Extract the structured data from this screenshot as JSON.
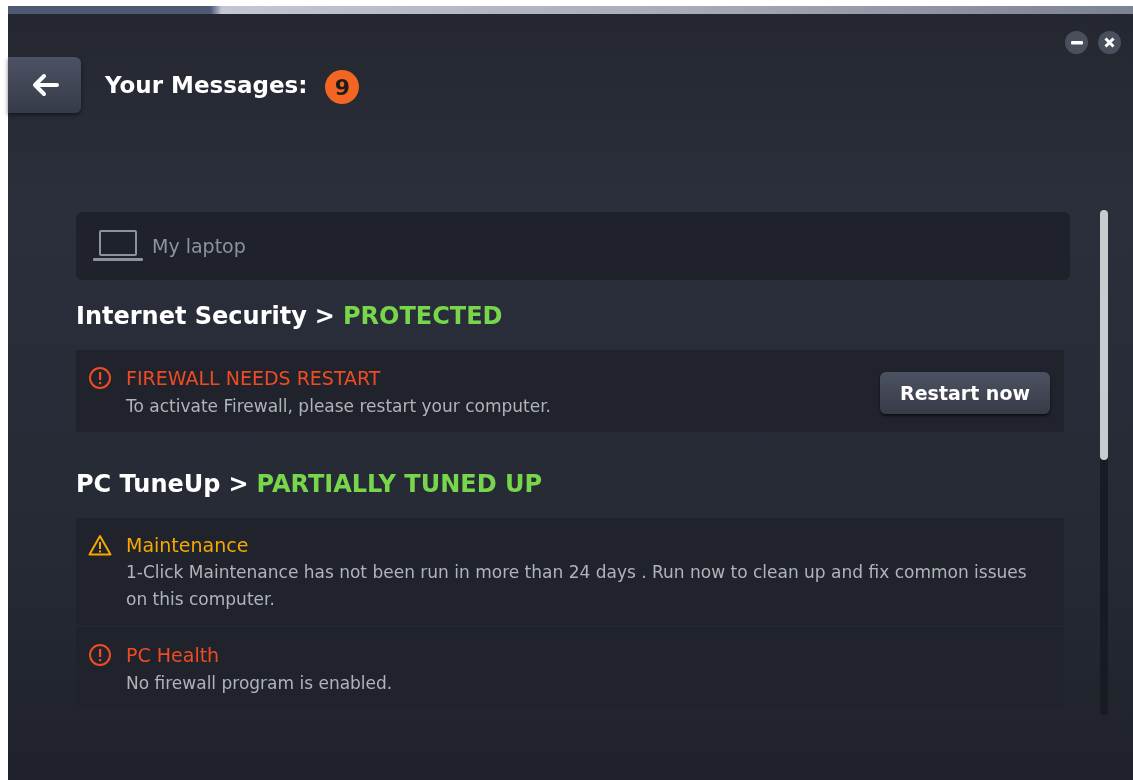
{
  "header": {
    "title": "Your Messages:",
    "count": "9"
  },
  "device": {
    "name": "My laptop"
  },
  "sections": [
    {
      "name": "Internet Security",
      "separator": ">",
      "status": "PROTECTED",
      "messages": [
        {
          "kind": "error",
          "title": "FIREWALL NEEDS RESTART",
          "text": "To activate Firewall, please restart your computer.",
          "action": "Restart now"
        }
      ]
    },
    {
      "name": "PC TuneUp",
      "separator": ">",
      "status": "PARTIALLY TUNED UP",
      "messages": [
        {
          "kind": "warning",
          "title": "Maintenance",
          "text": "1-Click Maintenance has not been run in more than 24 days . Run now to clean up and fix common issues on this computer."
        },
        {
          "kind": "error",
          "title": "PC Health",
          "text": "No firewall program is enabled."
        }
      ]
    }
  ]
}
